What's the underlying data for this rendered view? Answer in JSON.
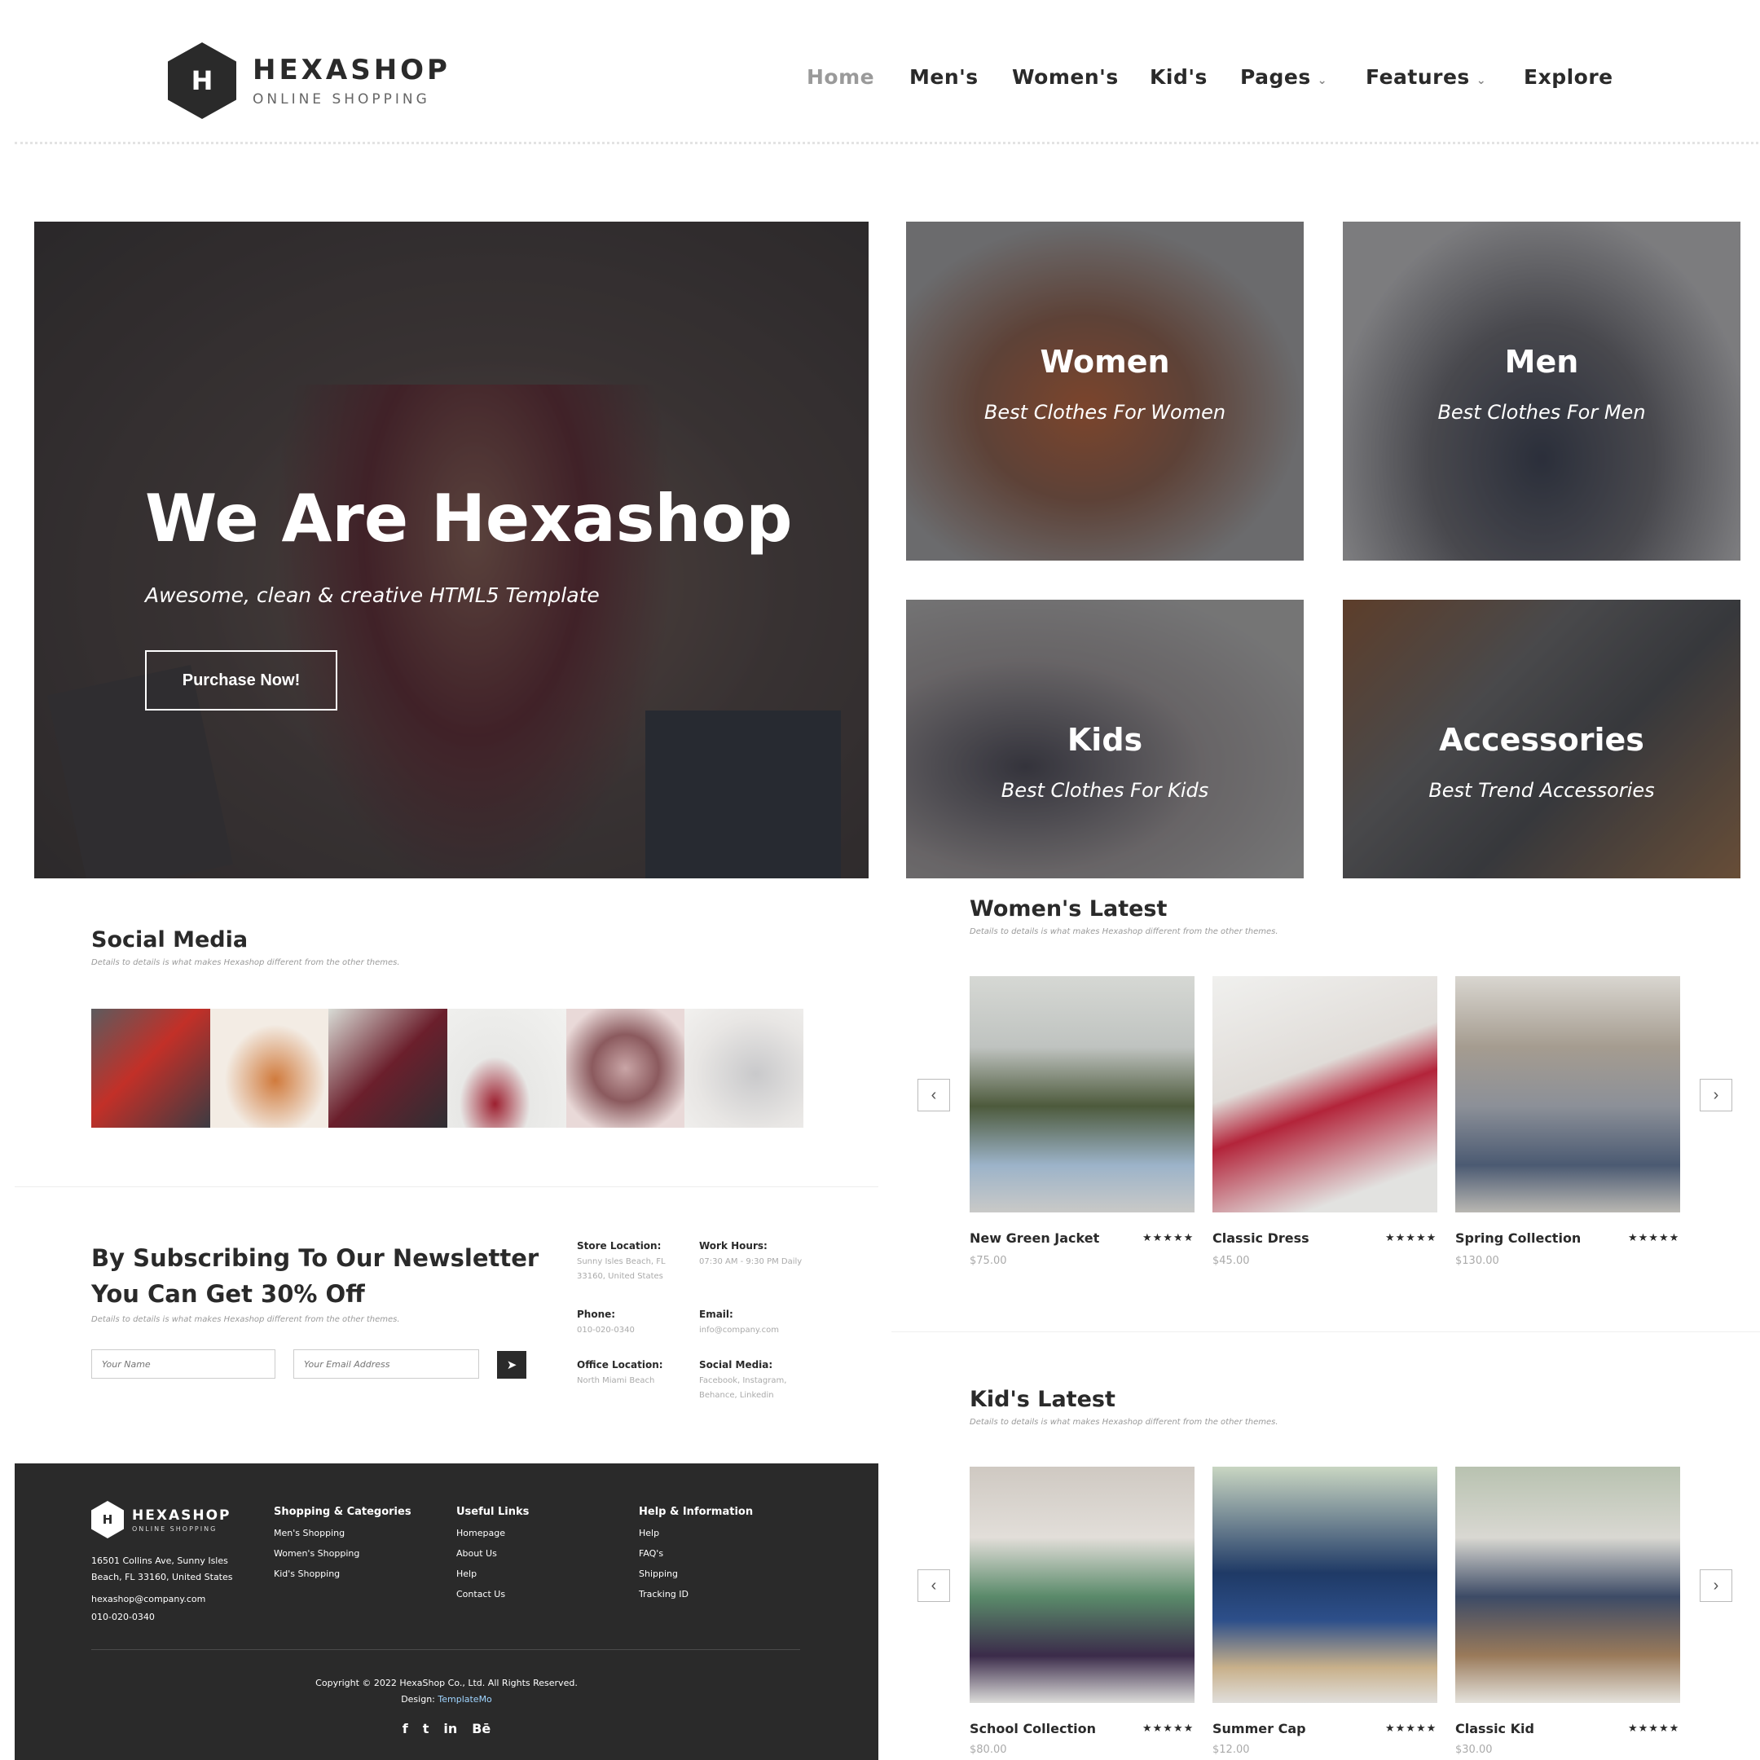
{
  "header": {
    "logo_mark": "H",
    "logo_title": "HEXASHOP",
    "logo_subtitle": "ONLINE SHOPPING",
    "nav": [
      {
        "label": "Home",
        "active": true
      },
      {
        "label": "Men's"
      },
      {
        "label": "Women's"
      },
      {
        "label": "Kid's"
      },
      {
        "label": "Pages",
        "dropdown": true
      },
      {
        "label": "Features",
        "dropdown": true
      },
      {
        "label": "Explore"
      }
    ]
  },
  "hero": {
    "title": "We Are Hexashop",
    "subtitle": "Awesome, clean & creative HTML5 Template",
    "button": "Purchase Now!"
  },
  "categories": [
    {
      "title": "Women",
      "subtitle": "Best Clothes For Women"
    },
    {
      "title": "Men",
      "subtitle": "Best Clothes For Men"
    },
    {
      "title": "Kids",
      "subtitle": "Best Clothes For Kids"
    },
    {
      "title": "Accessories",
      "subtitle": "Best Trend Accessories"
    }
  ],
  "social": {
    "title": "Social Media",
    "description": "Details to details is what makes Hexashop different from the other themes."
  },
  "newsletter": {
    "title": "By Subscribing To Our Newsletter You Can Get 30% Off",
    "description": "Details to details is what makes Hexashop different from the other themes.",
    "name_placeholder": "Your Name",
    "email_placeholder": "Your Email Address",
    "send_icon": "paper-plane-icon"
  },
  "contact_info": [
    {
      "label": "Store Location:",
      "value": "Sunny Isles Beach, FL 33160, United States"
    },
    {
      "label": "Work Hours:",
      "value": "07:30 AM - 9:30 PM Daily"
    },
    {
      "label": "Phone:",
      "value": "010-020-0340"
    },
    {
      "label": "Email:",
      "value": "info@company.com"
    },
    {
      "label": "Office Location:",
      "value": "North Miami Beach"
    },
    {
      "label": "Social Media:",
      "value": "Facebook, Instagram, Behance, Linkedin"
    }
  ],
  "footer": {
    "logo_mark": "H",
    "logo_title": "HEXASHOP",
    "logo_subtitle": "ONLINE SHOPPING",
    "address": "16501 Collins Ave, Sunny Isles Beach, FL 33160, United States",
    "email": "hexashop@company.com",
    "phone": "010-020-0340",
    "columns": [
      {
        "title": "Shopping & Categories",
        "links": [
          "Men's Shopping",
          "Women's Shopping",
          "Kid's Shopping"
        ]
      },
      {
        "title": "Useful Links",
        "links": [
          "Homepage",
          "About Us",
          "Help",
          "Contact Us"
        ]
      },
      {
        "title": "Help & Information",
        "links": [
          "Help",
          "FAQ's",
          "Shipping",
          "Tracking ID"
        ]
      }
    ],
    "copyright": "Copyright © 2022 HexaShop Co., Ltd. All Rights Reserved.",
    "design_prefix": "Design: ",
    "design_link": "TemplateMo",
    "social_icons": [
      "f",
      "t",
      "in",
      "Bē"
    ]
  },
  "womens_latest": {
    "title": "Women's Latest",
    "description": "Details to details is what makes Hexashop different from the other themes.",
    "products": [
      {
        "name": "New Green Jacket",
        "price": "$75.00",
        "stars": "★★★★★"
      },
      {
        "name": "Classic Dress",
        "price": "$45.00",
        "stars": "★★★★★"
      },
      {
        "name": "Spring Collection",
        "price": "$130.00",
        "stars": "★★★★★"
      }
    ]
  },
  "kids_latest": {
    "title": "Kid's Latest",
    "description": "Details to details is what makes Hexashop different from the other themes.",
    "products": [
      {
        "name": "School Collection",
        "price": "$80.00",
        "stars": "★★★★★"
      },
      {
        "name": "Summer Cap",
        "price": "$12.00",
        "stars": "★★★★★"
      },
      {
        "name": "Classic Kid",
        "price": "$30.00",
        "stars": "★★★★★"
      }
    ]
  },
  "carousel": {
    "prev": "‹",
    "next": "›"
  },
  "colors": {
    "dark": "#2a2a2a",
    "muted": "#9a9a9a",
    "link": "#9fd4ff"
  }
}
